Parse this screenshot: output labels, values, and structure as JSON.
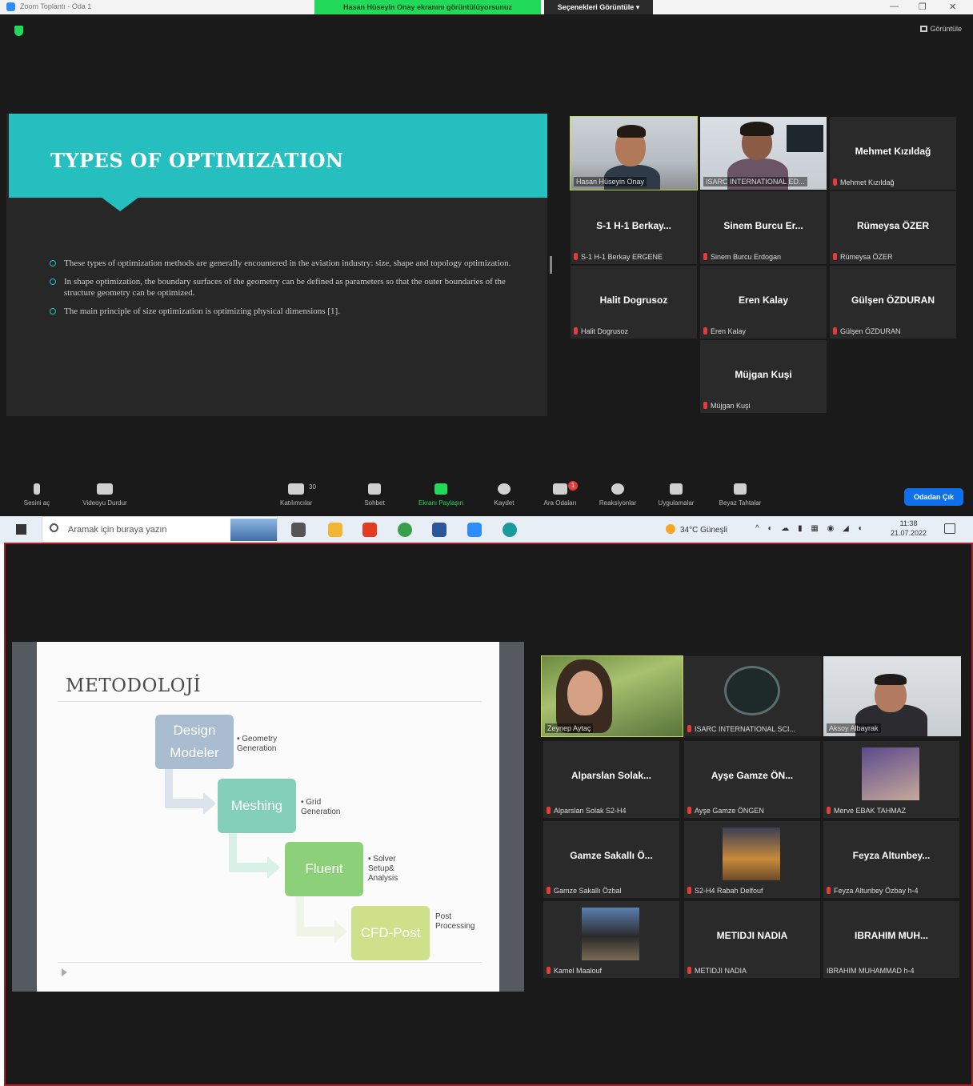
{
  "top_window": {
    "title": "Zoom Toplantı - Oda 1",
    "share_banner": "Hasan Hüseyin Onay ekranını görüntülüyorsunuz",
    "view_options": "Seçenekleri Görüntüle",
    "view_button": "Görüntüle",
    "slide": {
      "title": "TYPES OF OPTIMIZATION",
      "bullets": [
        "These types of optimization methods are generally encountered in the aviation industry: size, shape and topology optimization.",
        "In shape optimization, the boundary surfaces of the geometry can be defined as parameters so that the outer boundaries of the structure geometry can be optimized.",
        "The main principle of size optimization is optimizing physical dimensions [1]."
      ]
    },
    "participants": [
      {
        "display": "",
        "label": "Hasan Hüseyin Onay",
        "active": true
      },
      {
        "display": "",
        "label": "ISARC INTERNATIONAL ED...",
        "active": false
      },
      {
        "display": "Mehmet Kızıldağ",
        "label": "Mehmet Kızıldağ"
      },
      {
        "display": "S-1 H-1 Berkay...",
        "label": "S-1 H-1 Berkay ERGENE"
      },
      {
        "display": "Sinem Burcu Er...",
        "label": "Sinem Burcu Erdogan"
      },
      {
        "display": "Rümeysa ÖZER",
        "label": "Rümeysa ÖZER"
      },
      {
        "display": "Halit Dogrusoz",
        "label": "Halit Dogrusoz"
      },
      {
        "display": "Eren Kalay",
        "label": "Eren Kalay"
      },
      {
        "display": "Gülşen ÖZDURAN",
        "label": "Gülşen ÖZDURAN"
      },
      {
        "display": "Müjgan Kuşi",
        "label": "Müjgan Kuşi"
      }
    ],
    "toolbar": {
      "mute": "Sesini aç",
      "video": "Videoyu Durdur",
      "participants": "Katılımcılar",
      "participants_count": "30",
      "chat": "Sohbet",
      "share": "Ekranı Paylaşın",
      "record": "Kaydet",
      "breakout": "Ara Odaları",
      "breakout_badge": "1",
      "reactions": "Reaksiyonlar",
      "apps": "Uygulamalar",
      "whiteboard": "Beyaz Tahtalar",
      "leave": "Odadan Çık"
    }
  },
  "taskbar": {
    "search_placeholder": "Aramak için buraya yazın",
    "weather": "34°C  Güneşli",
    "time": "11:38",
    "date": "21.07.2022"
  },
  "bottom_window": {
    "slide": {
      "title": "METODOLOJİ",
      "steps": [
        {
          "box": "Design Modeler",
          "note": "• Geometry Generation"
        },
        {
          "box": "Meshing",
          "note": "• Grid Generation"
        },
        {
          "box": "Fluent",
          "note": "• Solver Setup& Analysis"
        },
        {
          "box": "CFD-Post",
          "note": "Post Processing"
        }
      ]
    },
    "participants": [
      {
        "display": "",
        "label": "Zeynep Aytaç",
        "active": true
      },
      {
        "display": "",
        "label": "ISARC INTERNATIONAL SCI..."
      },
      {
        "display": "",
        "label": "Aksoy Albayrak"
      },
      {
        "display": "Alparslan Solak...",
        "label": "Alparslan Solak S2-H4"
      },
      {
        "display": "Ayşe Gamze ÖN...",
        "label": "Ayşe Gamze ÖNGEN"
      },
      {
        "display": "",
        "label": "Merve EBAK TAHMAZ"
      },
      {
        "display": "Gamze Sakallı Ö...",
        "label": "Gamze Sakallı Özbal"
      },
      {
        "display": "",
        "label": "S2-H4 Rabah Delfouf"
      },
      {
        "display": "Feyza Altunbey...",
        "label": "Feyza Altunbey Özbay h-4"
      },
      {
        "display": "",
        "label": "Kamel Maalouf"
      },
      {
        "display": "METIDJI NADIA",
        "label": "METIDJI NADIA"
      },
      {
        "display": "IBRAHIM MUH...",
        "label": "IBRAHIM MUHAMMAD h-4"
      }
    ]
  }
}
